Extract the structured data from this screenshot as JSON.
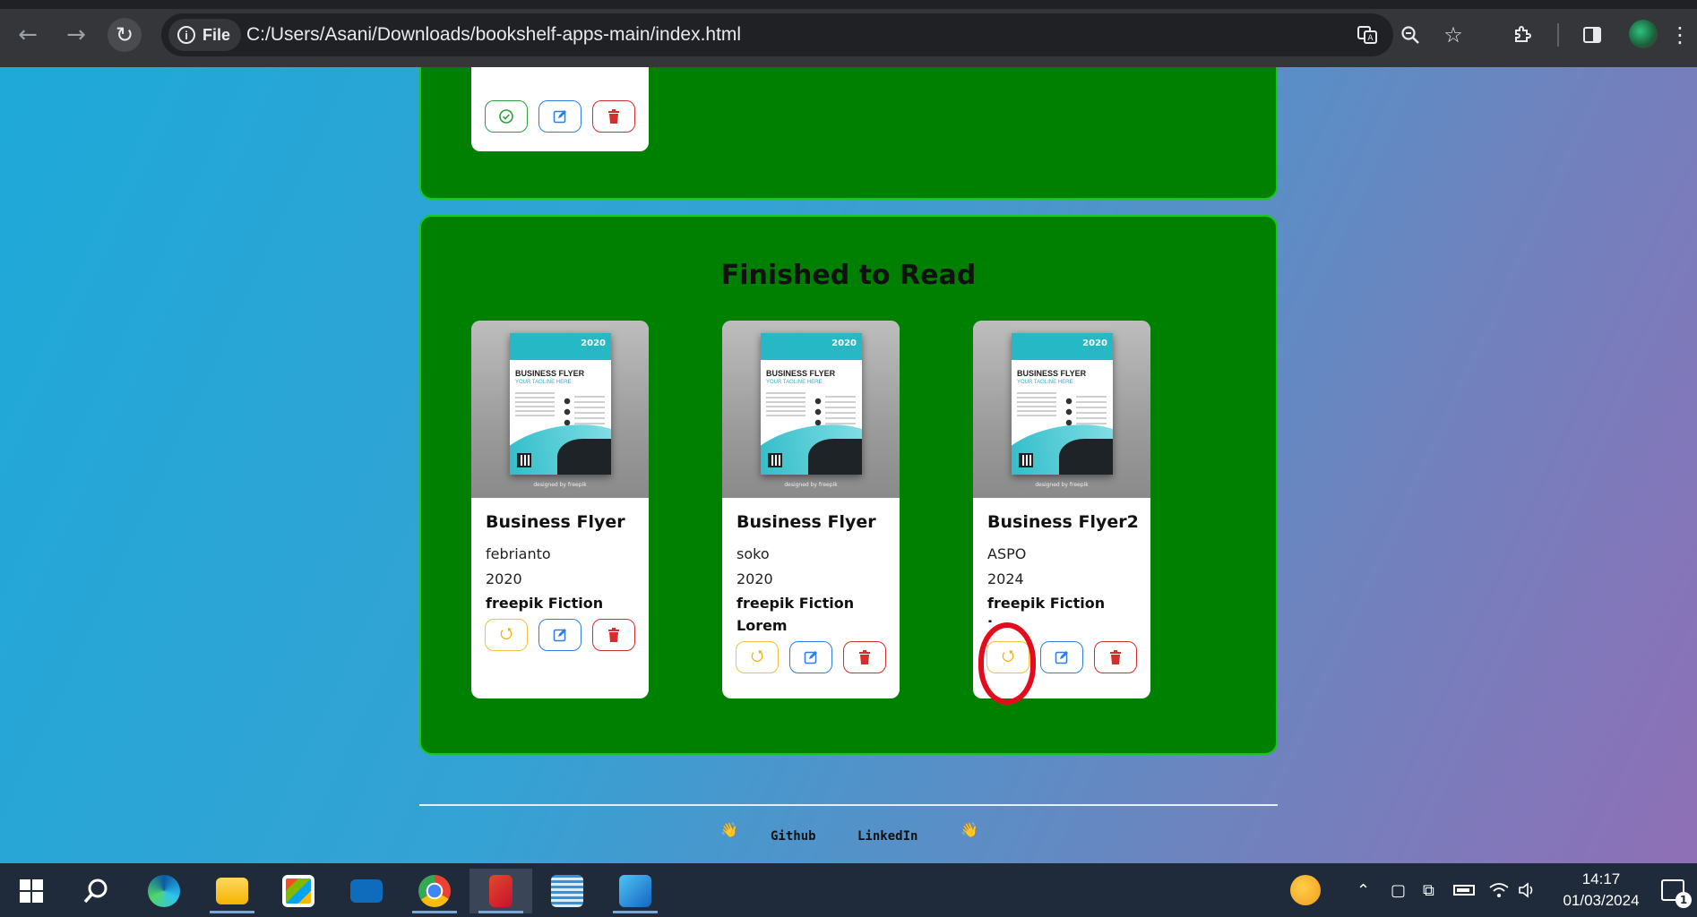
{
  "browser": {
    "chip_label": "File",
    "url": "C:/Users/Asani/Downloads/bookshelf-apps-main/index.html"
  },
  "shelf_finished": {
    "title": "Finished to Read",
    "books": [
      {
        "title": "Business Flyer",
        "author": "febrianto",
        "year": "2020",
        "category": "freepik Fiction"
      },
      {
        "title": "Business Flyer",
        "author": "soko",
        "year": "2020",
        "category": "freepik Fiction Lorem"
      },
      {
        "title": "Business Flyer2",
        "author": "ASPO",
        "year": "2024",
        "category": "freepik Fiction Lorem"
      }
    ]
  },
  "cover": {
    "year": "2020",
    "title": "BUSINESS FLYER",
    "subtitle": "YOUR TAGLINE HERE",
    "credit": "designed by freepik"
  },
  "footer": {
    "links": [
      "Github",
      "LinkedIn"
    ]
  },
  "taskbar": {
    "time": "14:17",
    "date": "01/03/2024",
    "notification_count": "1"
  },
  "icons": {
    "undo": "refresh-icon",
    "edit": "edit-icon",
    "delete": "trash-icon",
    "done": "check-circle-icon"
  },
  "colors": {
    "shelf": "#008000",
    "shelf_border": "#17c917",
    "highlight": "#e30b1c"
  }
}
